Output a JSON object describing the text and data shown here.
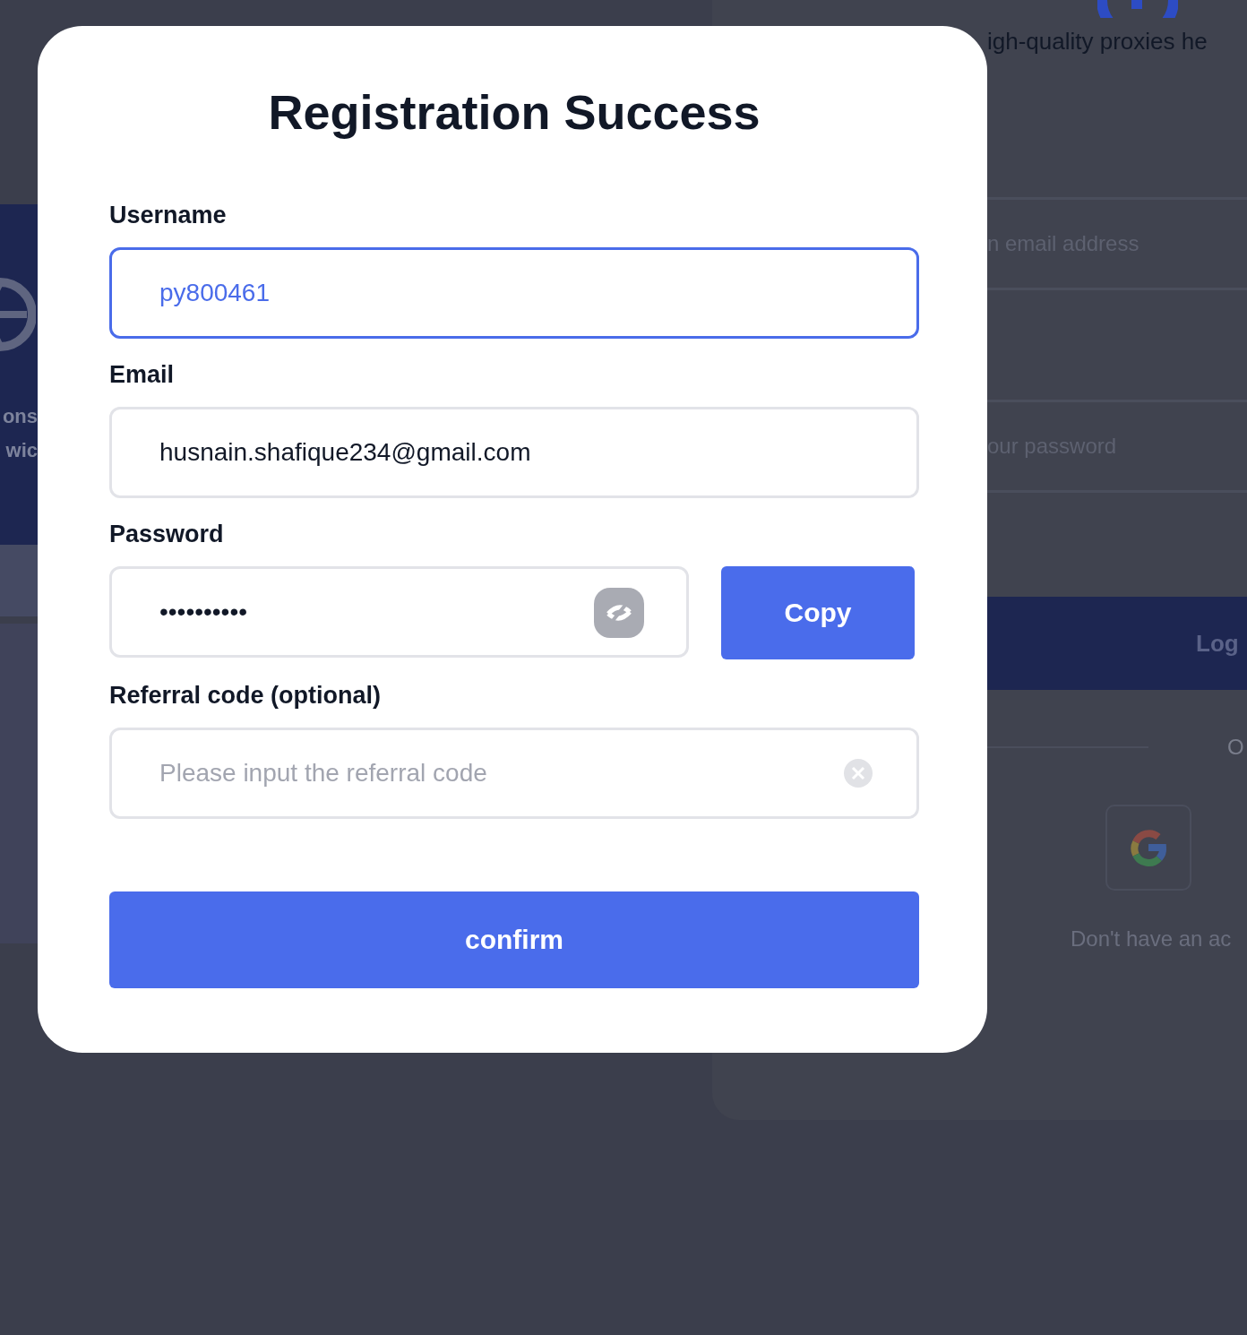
{
  "background": {
    "side_texts": [
      "ons",
      "wic"
    ],
    "login_card": {
      "tagline": "igh-quality proxies he",
      "email_placeholder": "n email address",
      "password_placeholder": "our password",
      "login_button": "Log",
      "divider_text": "O",
      "signup_text": "Don't have an ac"
    }
  },
  "dialog": {
    "title": "Registration Success",
    "fields": [
      {
        "kind": "text",
        "label": "Username",
        "value": "py800461",
        "focused": true
      },
      {
        "kind": "text",
        "label": "Email",
        "value": "husnain.shafique234@gmail.com",
        "focused": false
      },
      {
        "kind": "password",
        "label": "Password",
        "value": "••••••••••",
        "focused": false,
        "button": "Copy"
      },
      {
        "kind": "clearable",
        "label": "Referral code (optional)",
        "placeholder": "Please input the referral code",
        "focused": false
      }
    ],
    "confirm_button": "confirm"
  }
}
